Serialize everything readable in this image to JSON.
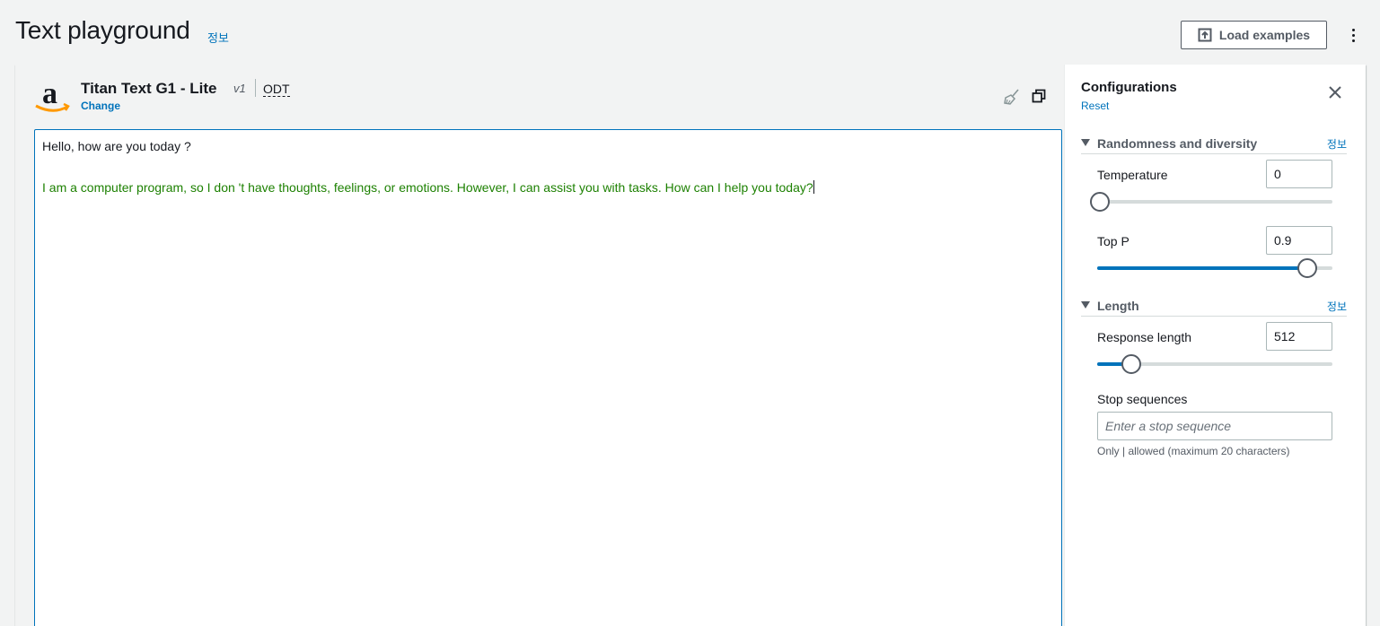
{
  "header": {
    "title": "Text playground",
    "info_label": "정보",
    "load_examples_label": "Load examples",
    "load_icon": "upload-icon",
    "more_icon": "kebab-menu-icon"
  },
  "model": {
    "logo": "amazon-logo",
    "name": "Titan Text G1 - Lite",
    "version": "v1",
    "throughput": "ODT",
    "change_label": "Change",
    "clear_icon": "broom-icon",
    "compare_icon": "copy-icon"
  },
  "editor": {
    "prompt": "Hello, how are you today ?",
    "response": "I am a computer program, so I don 't have thoughts, feelings, or emotions. However, I can assist you with tasks. How can I help you today?"
  },
  "config": {
    "title": "Configurations",
    "reset_label": "Reset",
    "close_icon": "close-icon",
    "randomness": {
      "label": "Randomness and diversity",
      "info_label": "정보",
      "temperature": {
        "label": "Temperature",
        "value": "0",
        "fraction": 0.0
      },
      "top_p": {
        "label": "Top P",
        "value": "0.9",
        "fraction": 0.9
      }
    },
    "length": {
      "label": "Length",
      "info_label": "정보",
      "response_length": {
        "label": "Response length",
        "value": "512",
        "fraction": 0.14
      },
      "stop_sequences": {
        "label": "Stop sequences",
        "placeholder": "Enter a stop sequence",
        "hint": "Only | allowed (maximum 20 characters)"
      }
    }
  },
  "colors": {
    "accent": "#0073bb",
    "response_text": "#1d8102",
    "background": "#f2f3f3"
  }
}
